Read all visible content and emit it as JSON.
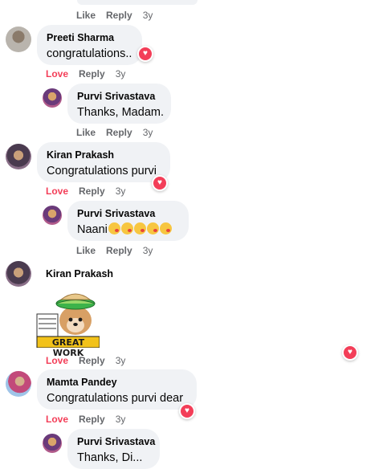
{
  "actions": {
    "like": "Like",
    "love": "Love",
    "reply": "Reply",
    "age": "3y"
  },
  "comments": [
    {
      "author": "Preeti Sharma",
      "text": "congratulations.."
    },
    {
      "author": "Purvi Srivastava",
      "text": "Thanks, Madam."
    },
    {
      "author": "Kiran Prakash",
      "text": "Congratulations purvi"
    },
    {
      "author": "Purvi Srivastava",
      "text": "Naani"
    },
    {
      "author": "Kiran Prakash",
      "sticker_text": "GREAT WORK"
    },
    {
      "author": "Mamta Pandey",
      "text": "Congratulations purvi dear"
    },
    {
      "author": "Purvi Srivastava",
      "text": "Thanks, Di..."
    }
  ],
  "icons": {
    "reaction": "heart-icon",
    "emoji": "kissing-face-emoji-icon"
  },
  "colors": {
    "love": "#f33e58",
    "bubble": "#f0f2f5",
    "meta": "#65676b"
  }
}
